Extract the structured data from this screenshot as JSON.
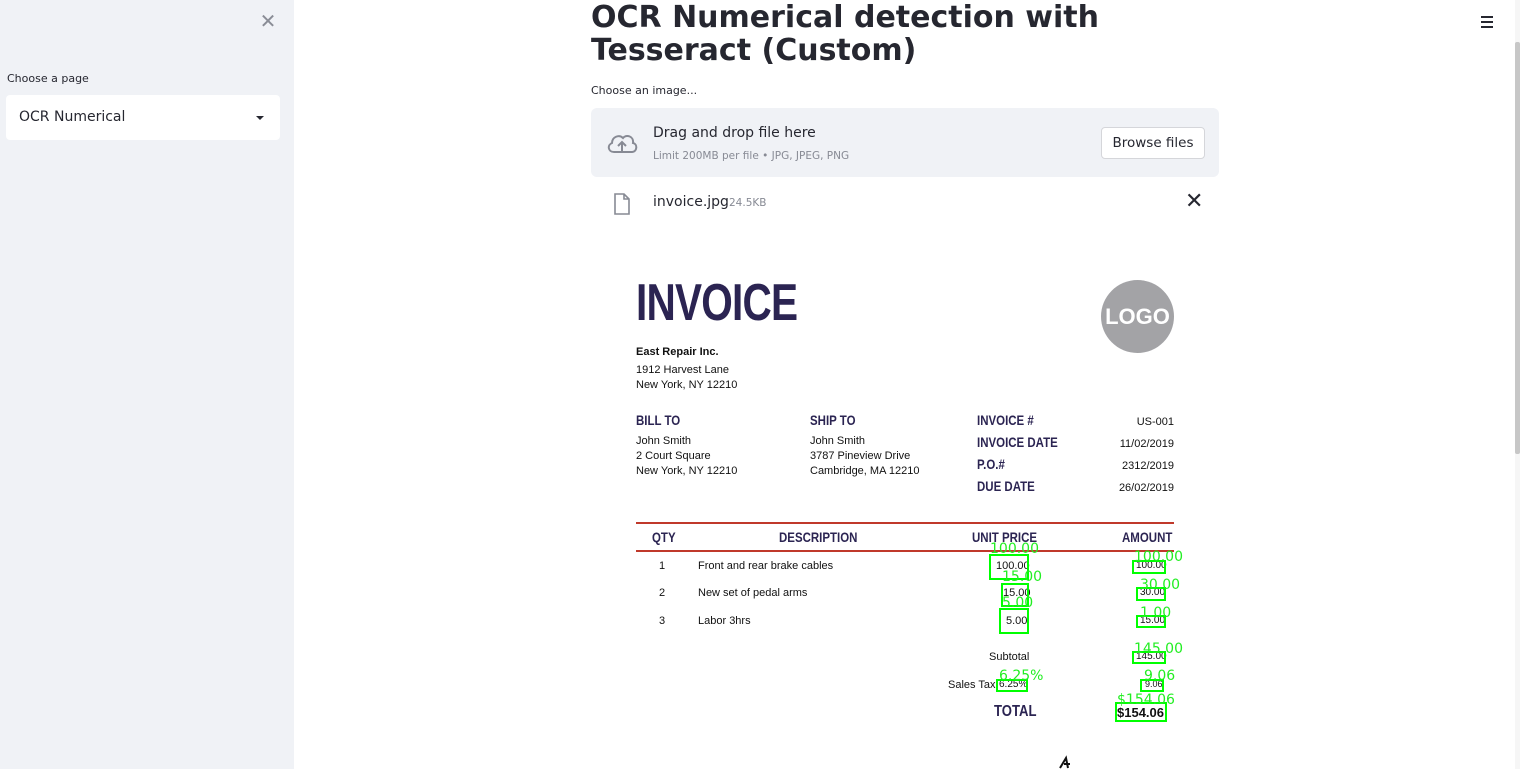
{
  "sidebar": {
    "close_glyph": "✕",
    "page_label": "Choose a page",
    "selected_page": "OCR Numerical"
  },
  "header": {
    "title": "OCR Numerical detection with Tesseract (Custom)",
    "menu_icon": "hamburger-icon"
  },
  "uploader": {
    "label": "Choose an image...",
    "drop_title": "Drag and drop file here",
    "limit_text": "Limit 200MB per file • JPG, JPEG, PNG",
    "browse_label": "Browse files",
    "icon": "cloud-upload-icon"
  },
  "file": {
    "name": "invoice.jpg",
    "size": "24.5KB",
    "icon": "file-icon",
    "remove_glyph": "✕"
  },
  "invoice": {
    "title": "INVOICE",
    "logo": "LOGO",
    "company": "East Repair Inc.",
    "company_address_1": "1912 Harvest Lane",
    "company_address_2": "New York, NY 12210",
    "bill_to_label": "BILL TO",
    "bill_to": [
      "John Smith",
      "2 Court Square",
      "New York, NY 12210"
    ],
    "ship_to_label": "SHIP TO",
    "ship_to": [
      "John Smith",
      "3787 Pineview Drive",
      "Cambridge, MA 12210"
    ],
    "meta_labels": [
      "INVOICE #",
      "INVOICE DATE",
      "P.O.#",
      "DUE DATE"
    ],
    "meta_values": [
      "US-001",
      "11/02/2019",
      "2312/2019",
      "26/02/2019"
    ],
    "columns": [
      "QTY",
      "DESCRIPTION",
      "UNIT PRICE",
      "AMOUNT"
    ],
    "rows": [
      {
        "qty": "1",
        "description": "Front and rear brake cables",
        "unit_price": "100.00",
        "amount": "100.00"
      },
      {
        "qty": "2",
        "description": "New set of pedal arms",
        "unit_price": "15.00",
        "amount": "30.00"
      },
      {
        "qty": "3",
        "description": "Labor 3hrs",
        "unit_price": "5.00",
        "amount": "15.00"
      }
    ],
    "subtotal_label": "Subtotal",
    "subtotal": "145.00",
    "tax_label": "Sales Tax",
    "tax_rate": "6.25%",
    "tax_amount": "9.06",
    "total_label": "TOTAL",
    "total": "$154.06",
    "ocr_color": "#00ff00",
    "ocr_detections": [
      "100.00",
      "15.00",
      "5.00",
      "100.00",
      "30.00",
      "1.00",
      "145.00",
      "6.25%",
      "9.06",
      "$154.06"
    ]
  }
}
